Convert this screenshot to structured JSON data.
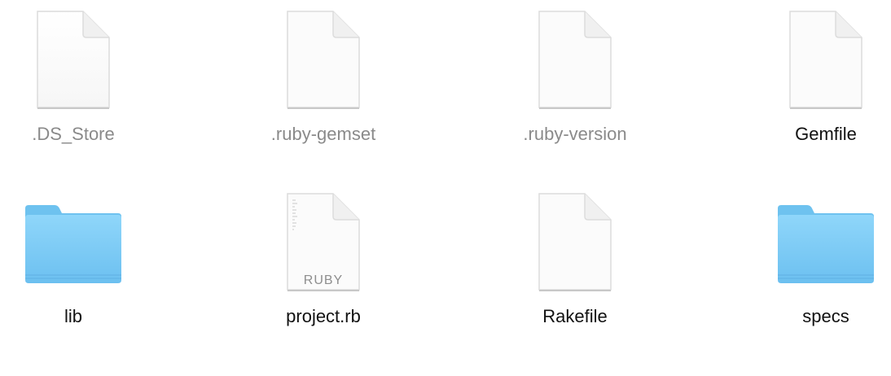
{
  "window": {
    "view": "icon-view"
  },
  "files": [
    {
      "name": ".DS_Store",
      "kind": "document",
      "hidden": true
    },
    {
      "name": ".ruby-gemset",
      "kind": "document",
      "hidden": true
    },
    {
      "name": ".ruby-version",
      "kind": "document",
      "hidden": true
    },
    {
      "name": "Gemfile",
      "kind": "document",
      "hidden": false
    },
    {
      "name": "lib",
      "kind": "folder",
      "hidden": false
    },
    {
      "name": "project.rb",
      "kind": "ruby-source",
      "hidden": false,
      "badge": "RUBY"
    },
    {
      "name": "Rakefile",
      "kind": "document",
      "hidden": false
    },
    {
      "name": "specs",
      "kind": "folder",
      "hidden": false
    }
  ],
  "colors": {
    "hidden_label": "#8a8a8a",
    "label": "#111111",
    "folder_top": "#7dcdf5",
    "folder_bottom": "#5fb6ec"
  }
}
